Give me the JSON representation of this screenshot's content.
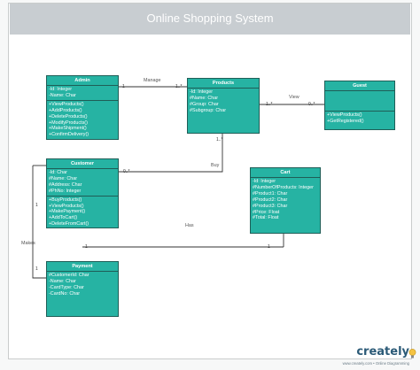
{
  "title": "Online Shopping System",
  "classes": {
    "admin": {
      "name": "Admin",
      "attributes": [
        "-Id: Integer",
        "-Name: Char"
      ],
      "methods": [
        "+ViewProducts()",
        "+AddProducts()",
        "+DeleteProducts()",
        "+ModifyProducts()",
        "+MakeShipment()",
        "+ConfirmDelivery()"
      ]
    },
    "products": {
      "name": "Products",
      "attributes": [
        "-Id: Integer",
        "#Name: Char",
        "#Group: Char",
        "#Subgroup: Char"
      ],
      "methods": []
    },
    "guest": {
      "name": "Guest",
      "attributes": [],
      "methods": [
        "+ViewProducts()",
        "+GetRegistered()"
      ]
    },
    "customer": {
      "name": "Customer",
      "attributes": [
        "-Id: Char",
        "#Name: Char",
        "#Address: Char",
        "#PhNo: Integer"
      ],
      "methods": [
        "+BuyProducts()",
        "+ViewProducts()",
        "+MakePayment()",
        "+AddToCart()",
        "+DeleteFromCart()"
      ]
    },
    "cart": {
      "name": "Cart",
      "attributes": [
        "-Id: Integer",
        "#NumberOfProducts: Integer",
        "#Product1: Char",
        "#Product2: Char",
        "#Product3: Char",
        "#Price: Float",
        "#Total: Float"
      ],
      "methods": []
    },
    "payment": {
      "name": "Payment",
      "attributes": [
        "#CustomerId: Char",
        "-Name: Char",
        "-CardType: Char",
        "-CardNo: Char"
      ],
      "methods": []
    }
  },
  "associations": {
    "manage": {
      "label": "Manage",
      "source_mult": "1",
      "target_mult": "1..*"
    },
    "view": {
      "label": "View",
      "source_mult": "1..*",
      "target_mult": "0..*"
    },
    "buy": {
      "label": "Buy",
      "source_mult": "0..*",
      "target_mult": "1..*"
    },
    "has": {
      "label": "Has",
      "source_mult": "1",
      "target_mult": "1"
    },
    "makes": {
      "label": "Makes",
      "source_mult": "1",
      "target_mult": "1"
    }
  },
  "branding": {
    "logo": "creately",
    "url": "www.creately.com • Online Diagramming"
  }
}
